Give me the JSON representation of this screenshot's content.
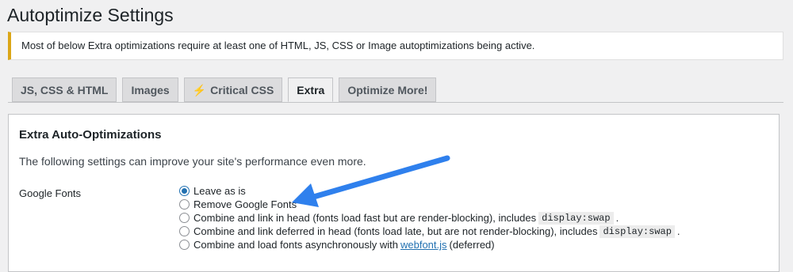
{
  "page": {
    "title": "Autoptimize Settings"
  },
  "notice": {
    "text": "Most of below Extra optimizations require at least one of HTML, JS, CSS or Image autoptimizations being active.",
    "border_color": "#dba617"
  },
  "tabs": [
    {
      "label": "JS, CSS & HTML",
      "active": false
    },
    {
      "label": "Images",
      "active": false
    },
    {
      "label": "Critical CSS",
      "icon": "lightning-bolt-icon",
      "active": false
    },
    {
      "label": "Extra",
      "active": true
    },
    {
      "label": "Optimize More!",
      "active": false
    }
  ],
  "panel": {
    "title": "Extra Auto-Optimizations",
    "description": "The following settings can improve your site's performance even more."
  },
  "google_fonts": {
    "label": "Google Fonts",
    "selected_index": 0,
    "options": [
      {
        "text": "Leave as is"
      },
      {
        "text": "Remove Google Fonts"
      },
      {
        "text": "Combine and link in head (fonts load fast but are render-blocking), includes",
        "code": "display:swap",
        "suffix": "."
      },
      {
        "text": "Combine and link deferred in head (fonts load late, but are not render-blocking), includes",
        "code": "display:swap",
        "suffix": "."
      },
      {
        "text": "Combine and load fonts asynchronously with",
        "link": "webfont.js",
        "suffix": "(deferred)"
      }
    ]
  },
  "annotation": {
    "arrow_color": "#2f80ed",
    "points_to": "Remove Google Fonts"
  },
  "colors": {
    "accent": "#2271b1",
    "background": "#f0f0f1"
  }
}
